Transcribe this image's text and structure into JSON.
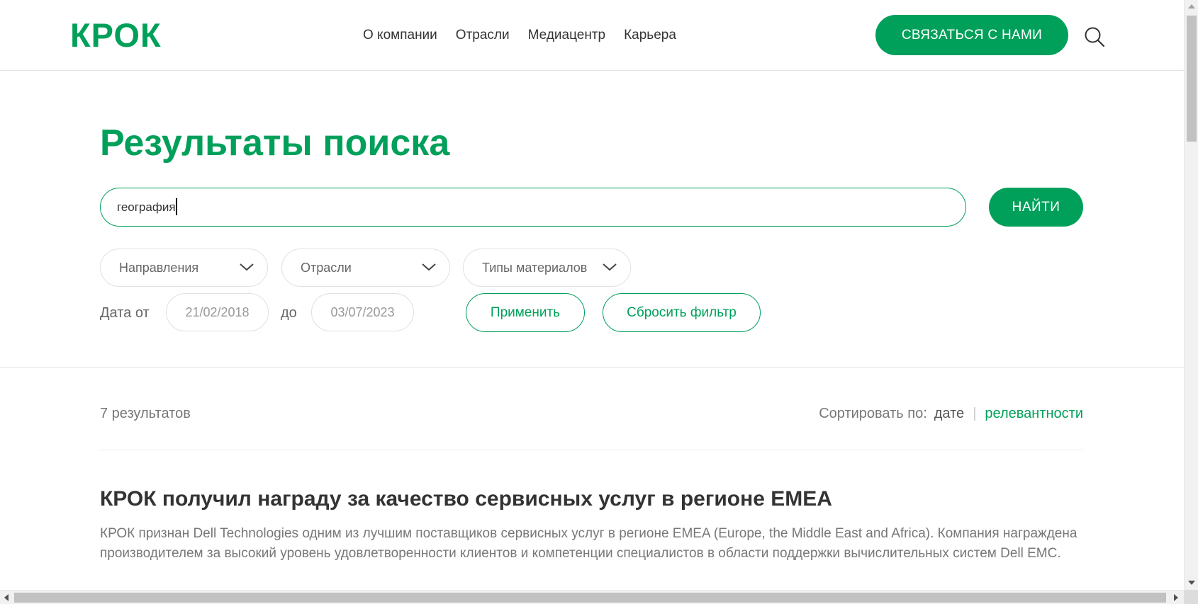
{
  "header": {
    "logo": "КРОК",
    "nav": [
      "О компании",
      "Отрасли",
      "Медиацентр",
      "Карьера"
    ],
    "contact_label": "СВЯЗАТЬСЯ С НАМИ"
  },
  "search": {
    "title": "Результаты поиска",
    "query": "география",
    "find_label": "НАЙТИ",
    "filters": [
      "Направления",
      "Отрасли",
      "Типы материалов"
    ],
    "date_from_label": "Дата от",
    "date_from_value": "21/02/2018",
    "date_to_label": "до",
    "date_to_value": "03/07/2023",
    "apply_label": "Применить",
    "reset_label": "Сбросить фильтр"
  },
  "results": {
    "count_text": "7 результатов",
    "sort_label": "Сортировать по:",
    "sort_date": "дате",
    "sort_relevance": "релевантности",
    "items": [
      {
        "title": "КРОК получил награду за качество сервисных услуг в регионе EMEA",
        "description": "КРОК признан Dell Technologies одним из лучшим поставщиков сервисных услуг в регионе EMEA (Europe, the Middle East and Africa). Компания награждена производителем за высокий уровень удовлетворенности клиентов и компетенции специалистов в области поддержки вычислительных систем Dell EMC."
      }
    ]
  },
  "colors": {
    "brand_green": "#00a05a",
    "text_dark": "#333333",
    "text_muted": "#777777"
  }
}
